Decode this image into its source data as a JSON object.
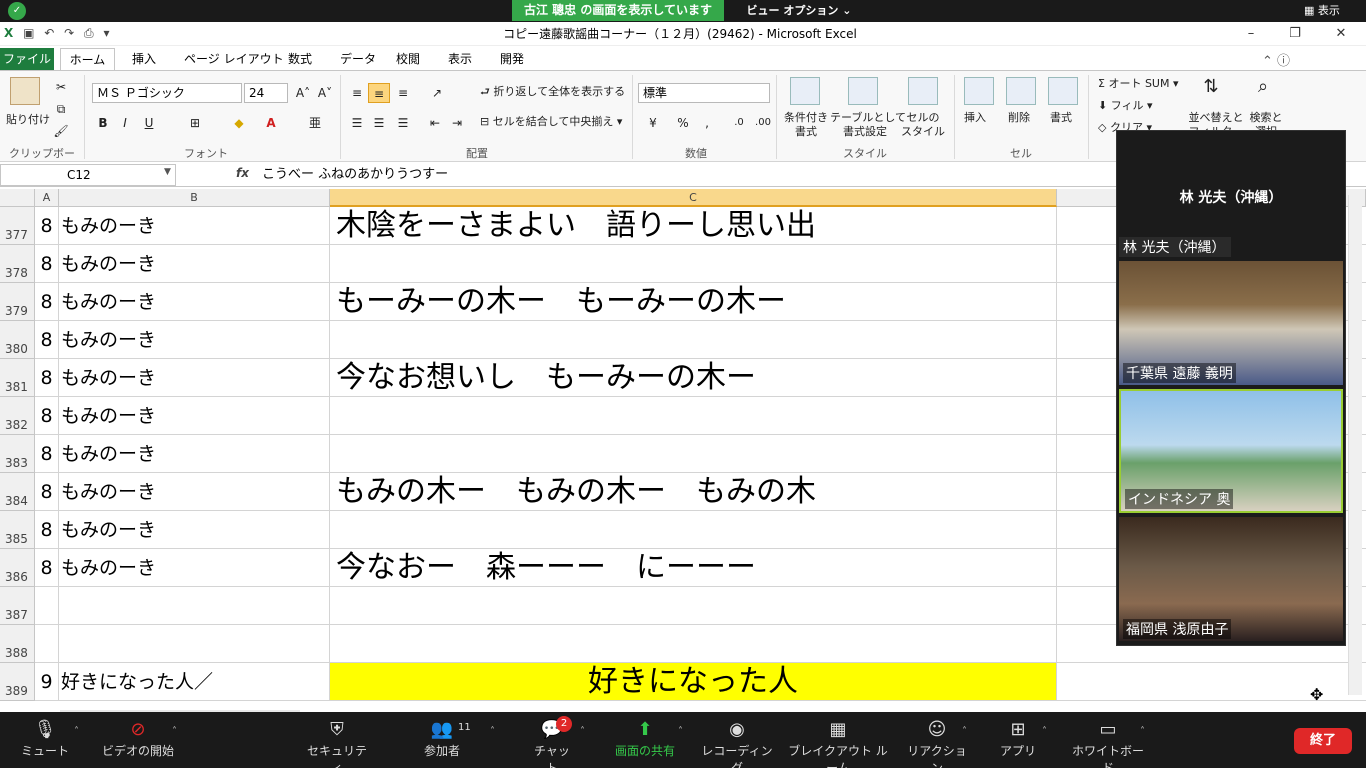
{
  "zoom": {
    "share_banner": "古江 聰忠 の画面を表示しています",
    "view_options": "ビュー オプション ⌄",
    "view_button": "表示",
    "toolbar": {
      "mute": "ミュート",
      "video": "ビデオの開始",
      "security": "セキュリティ",
      "participants": "参加者",
      "participants_count": "11",
      "chat": "チャット",
      "chat_badge": "2",
      "share": "画面の共有",
      "record": "レコーディング",
      "breakout": "ブレイクアウト ルーム",
      "reactions": "リアクション",
      "apps": "アプリ",
      "whiteboard": "ホワイトボード",
      "end": "終了"
    },
    "panel": {
      "speaker_name": "林 光夫（沖縄）",
      "self_label": "林 光夫（沖縄）",
      "videos": [
        {
          "label": "千葉県 遠藤 義明"
        },
        {
          "label": "インドネシア 奥"
        },
        {
          "label": "福岡県 浅原由子"
        }
      ]
    },
    "colors": {
      "share_green": "#35a84a",
      "end_red": "#e02828"
    }
  },
  "excel": {
    "window_title": "コピー遠藤歌謡曲コーナー（１２月）(29462) - Microsoft Excel",
    "tabs": [
      "ファイル",
      "ホーム",
      "挿入",
      "ページ レイアウト",
      "数式",
      "データ",
      "校閲",
      "表示",
      "開発"
    ],
    "ribbon": {
      "paste": "貼り付け",
      "clipboard": "クリップボード",
      "font_name": "ＭＳ Ｐゴシック",
      "font_size": "24",
      "font_group": "フォント",
      "wrap_text": "折り返して全体を表示する",
      "merge_center": "セルを結合して中央揃え",
      "alignment_group": "配置",
      "number_format": "標準",
      "number_group": "数値",
      "cond_format": "条件付き\n書式",
      "table_format": "テーブルとして\n書式設定",
      "cell_style": "セルの\nスタイル",
      "style_group": "スタイル",
      "insert": "挿入",
      "delete": "削除",
      "format": "書式",
      "cells_group": "セル",
      "autosum": "オート SUM",
      "fill": "フィル",
      "clear": "クリア",
      "sort": "並べ替えと\nフィルター",
      "find": "検索と\n選択"
    },
    "name_box": "C12",
    "formula": "こうべー ふねのあかりうつすー",
    "columns": [
      "A",
      "B",
      "C"
    ],
    "rows": [
      {
        "num": "377",
        "a": "8",
        "b": "もみのーき",
        "c": "木陰をーさまよい　語りーし思い出"
      },
      {
        "num": "378",
        "a": "8",
        "b": "もみのーき",
        "c": ""
      },
      {
        "num": "379",
        "a": "8",
        "b": "もみのーき",
        "c": "もーみーの木ー　もーみーの木ー"
      },
      {
        "num": "380",
        "a": "8",
        "b": "もみのーき",
        "c": ""
      },
      {
        "num": "381",
        "a": "8",
        "b": "もみのーき",
        "c": "今なお想いし　もーみーの木ー"
      },
      {
        "num": "382",
        "a": "8",
        "b": "もみのーき",
        "c": ""
      },
      {
        "num": "383",
        "a": "8",
        "b": "もみのーき",
        "c": ""
      },
      {
        "num": "384",
        "a": "8",
        "b": "もみのーき",
        "c": "もみの木ー　もみの木ー　もみの木"
      },
      {
        "num": "385",
        "a": "8",
        "b": "もみのーき",
        "c": ""
      },
      {
        "num": "386",
        "a": "8",
        "b": "もみのーき",
        "c": "今なおー　森ーーー　にーーー"
      },
      {
        "num": "387",
        "a": "",
        "b": "",
        "c": ""
      },
      {
        "num": "388",
        "a": "",
        "b": "",
        "c": ""
      },
      {
        "num": "389",
        "a": "9",
        "b": "好きになった人／",
        "c": "好きになった人"
      }
    ],
    "highlight_color": "#ffff00"
  }
}
